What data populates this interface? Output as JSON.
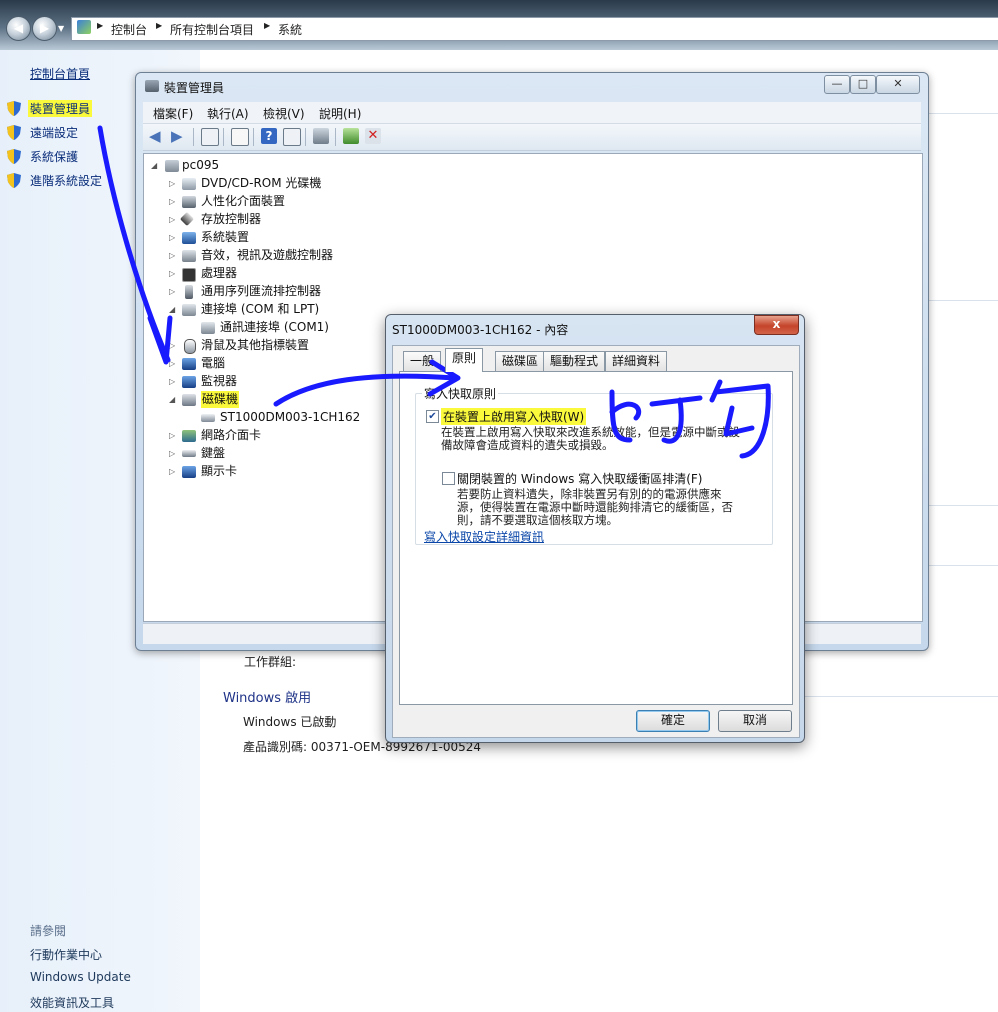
{
  "address_bar": {
    "crumbs": [
      "控制台",
      "所有控制台項目",
      "系統"
    ]
  },
  "left_pane": {
    "home": "控制台首頁",
    "tasks": [
      "裝置管理員",
      "遠端設定",
      "系統保護",
      "進階系統設定"
    ],
    "see_also_title": "請參閱",
    "see_also": [
      "行動作業中心",
      "Windows Update",
      "效能資訊及工具"
    ]
  },
  "background": {
    "workgroup_label": "工作群組:",
    "activation_heading": "Windows 啟用",
    "activation_status": "Windows 已啟動",
    "product_id": "產品識別碼: 00371-OEM-8992671-00524"
  },
  "device_manager": {
    "title": "裝置管理員",
    "menu": [
      "檔案(F)",
      "執行(A)",
      "檢視(V)",
      "說明(H)"
    ],
    "tree": {
      "root": "pc095",
      "items": [
        "DVD/CD-ROM 光碟機",
        "人性化介面裝置",
        "存放控制器",
        "系統裝置",
        "音效，視訊及遊戲控制器",
        "處理器",
        "通用序列匯流排控制器",
        "連接埠 (COM 和 LPT)",
        "通訊連接埠 (COM1)",
        "滑鼠及其他指標裝置",
        "電腦",
        "監視器",
        "磁碟機",
        "ST1000DM003-1CH162",
        "網路介面卡",
        "鍵盤",
        "顯示卡"
      ]
    }
  },
  "properties_dialog": {
    "title": "ST1000DM003-1CH162 - 內容",
    "close_label": "x",
    "tabs": [
      "一般",
      "原則",
      "磁碟區",
      "驅動程式",
      "詳細資料"
    ],
    "group_title": "寫入快取原則",
    "option1_label": "在裝置上啟用寫入快取(W)",
    "option1_checked": true,
    "option1_desc_line1": "在裝置上啟用寫入快取來改進系統效能，但是電源中斷或設",
    "option1_desc_line2": "備故障會造成資料的遺失或損毀。",
    "option2_label": "關閉裝置的 Windows 寫入快取緩衝區排清(F)",
    "option2_checked": false,
    "option2_desc_line1": "若要防止資料遺失，除非裝置另有別的的電源供應來",
    "option2_desc_line2": "源，使得裝置在電源中斷時還能夠排清它的緩衝區，否",
    "option2_desc_line3": "則，請不要選取這個核取方塊。",
    "link": "寫入快取設定詳細資訊",
    "ok": "確定",
    "cancel": "取消"
  },
  "annotation": {
    "handwriting": "打勾",
    "ink_color": "#1a1aff",
    "highlight_color": "#fbf93c"
  }
}
